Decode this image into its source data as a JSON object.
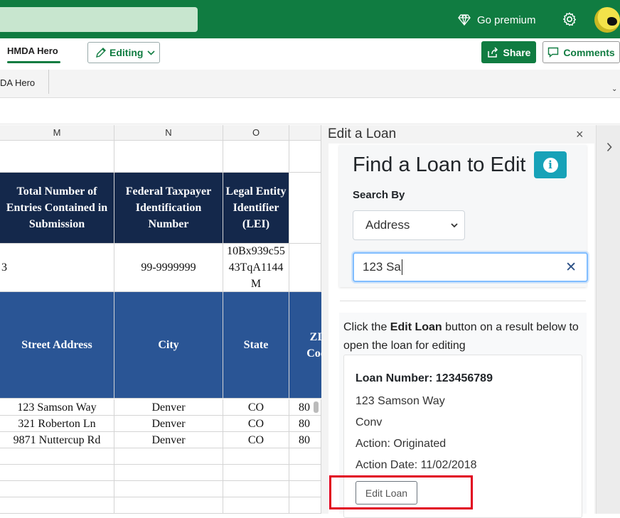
{
  "header": {
    "premium_label": "Go premium",
    "icons": [
      "diamond-icon",
      "gear-icon",
      "avatar"
    ]
  },
  "ribbon": {
    "active_tab": "HMDA Hero",
    "editing_label": "Editing",
    "share_label": "Share",
    "comments_label": "Comments",
    "group_label": "DA Hero"
  },
  "sheet": {
    "columns": [
      "M",
      "N",
      "O"
    ],
    "row1": [
      "",
      "",
      ""
    ],
    "header_row": [
      "Total Number of Entries Contained in Submission",
      "Federal Taxpayer Identification Number",
      "Legal Entity Identifier (LEI)"
    ],
    "value_row": [
      "3",
      "99-9999999",
      "10Bx939c5543TqA1144M"
    ],
    "address_header": [
      "Street Address",
      "City",
      "State",
      "ZIP Code"
    ],
    "rows": [
      [
        "123 Samson Way",
        "Denver",
        "CO",
        "80"
      ],
      [
        "321 Roberton Ln",
        "Denver",
        "CO",
        "80"
      ],
      [
        "9871 Nuttercup Rd",
        "Denver",
        "CO",
        "80"
      ]
    ]
  },
  "pane": {
    "title": "Edit a Loan",
    "close": "×",
    "find_title": "Find a Loan to Edit",
    "info": "i",
    "search_by_label": "Search By",
    "search_by_value": "Address",
    "search_text": "123 Sa",
    "clear": "✕",
    "instruction_prefix": "Click the ",
    "instruction_bold": "Edit Loan",
    "instruction_suffix": " button on a result below to open the loan for editing",
    "result": {
      "loan_number": "Loan Number: 123456789",
      "address": "123 Samson Way",
      "loan_type": "Conv",
      "action": "Action: Originated",
      "action_date": "Action Date: 11/02/2018",
      "edit_button": "Edit Loan"
    }
  },
  "colors": {
    "brand": "#107c41",
    "navy_header": "#14284b",
    "blue_header": "#2a5595",
    "info": "#17a2b8",
    "highlight": "#e1001f"
  }
}
